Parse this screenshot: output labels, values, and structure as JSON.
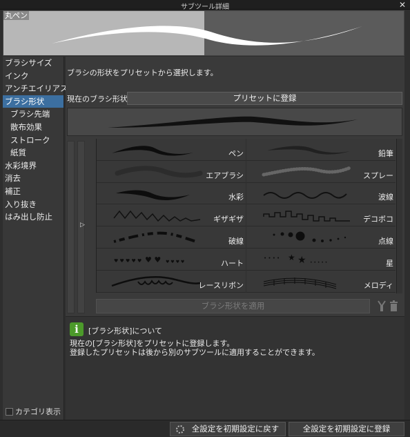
{
  "window": {
    "title": "サブツール詳細"
  },
  "preview": {
    "tool_name": "丸ペン"
  },
  "sidebar": {
    "items": [
      {
        "label": "ブラシサイズ"
      },
      {
        "label": "インク"
      },
      {
        "label": "アンチエイリアス"
      },
      {
        "label": "ブラシ形状"
      },
      {
        "label": "ブラシ先端"
      },
      {
        "label": "散布効果"
      },
      {
        "label": "ストローク"
      },
      {
        "label": "紙質"
      },
      {
        "label": "水彩境界"
      },
      {
        "label": "消去"
      },
      {
        "label": "補正"
      },
      {
        "label": "入り抜き"
      },
      {
        "label": "はみ出し防止"
      }
    ],
    "category_toggle_label": "カテゴリ表示"
  },
  "main": {
    "description": "ブラシの形状をプリセットから選択します。",
    "current_shape_label": "現在のブラシ形状",
    "register_preset_label": "プリセットに登録",
    "apply_label": "ブラシ形状を適用"
  },
  "presets": [
    {
      "label": "ペン"
    },
    {
      "label": "鉛筆"
    },
    {
      "label": "エアブラシ"
    },
    {
      "label": "スプレー"
    },
    {
      "label": "水彩"
    },
    {
      "label": "波線"
    },
    {
      "label": "ギザギザ"
    },
    {
      "label": "デコボコ"
    },
    {
      "label": "破線"
    },
    {
      "label": "点線"
    },
    {
      "label": "ハート"
    },
    {
      "label": "星"
    },
    {
      "label": "レースリボン"
    },
    {
      "label": "メロディ"
    }
  ],
  "info": {
    "title": "[ブラシ形状]について",
    "line1": "現在の[ブラシ形状]をプリセットに登録します。",
    "line2": "登録したプリセットは後から別のサブツールに適用することができます。"
  },
  "footer": {
    "reset_label": "全設定を初期設定に戻す",
    "register_label": "全設定を初期設定に登録"
  },
  "colors": {
    "active": "#3c6fa0",
    "info_icon": "#4c9a2a"
  }
}
